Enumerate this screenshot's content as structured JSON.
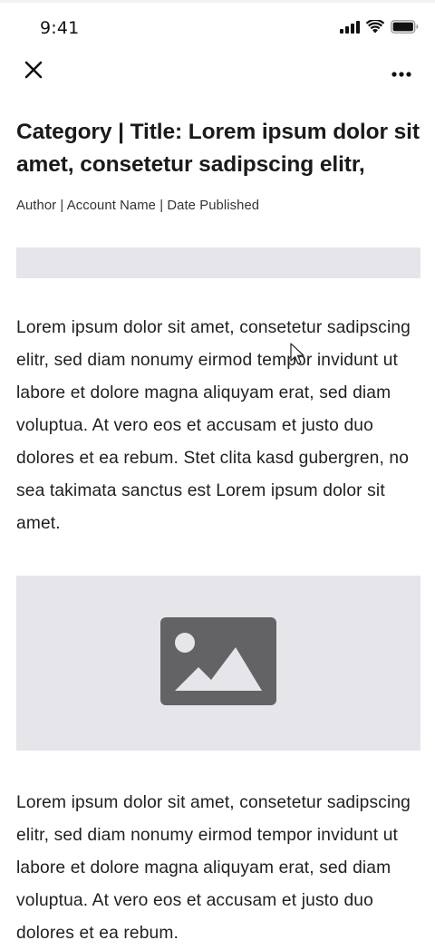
{
  "status_bar": {
    "time": "9:41",
    "icons": [
      "cellular-signal-icon",
      "wifi-icon",
      "battery-icon"
    ]
  },
  "nav": {
    "close_icon": "close-icon",
    "more_icon": "more-horizontal-icon"
  },
  "article": {
    "headline": "Category | Title: Lorem ipsum dolor sit amet, consetetur sadipscing elitr,",
    "byline": "Author | Account Name | Date Published",
    "paragraph_1": "Lorem ipsum dolor sit amet, consetetur sadipscing elitr, sed diam nonumy eirmod tempor invidunt ut labore et dolore magna aliquyam erat, sed diam voluptua. At vero eos et accusam et justo duo dolores et ea rebum. Stet clita kasd gubergren, no sea takimata sanctus est Lorem ipsum dolor sit amet.",
    "image_icon": "image-placeholder-icon",
    "paragraph_2": "Lorem ipsum dolor sit amet, consetetur sadipscing elitr, sed diam nonumy eirmod tempor invidunt ut labore et dolore magna aliquyam erat, sed diam voluptua. At vero eos et accusam et justo duo dolores et ea rebum."
  },
  "colors": {
    "placeholder_bg": "#e6e6ea",
    "placeholder_icon": "#636366",
    "text": "#1f1f1f"
  }
}
